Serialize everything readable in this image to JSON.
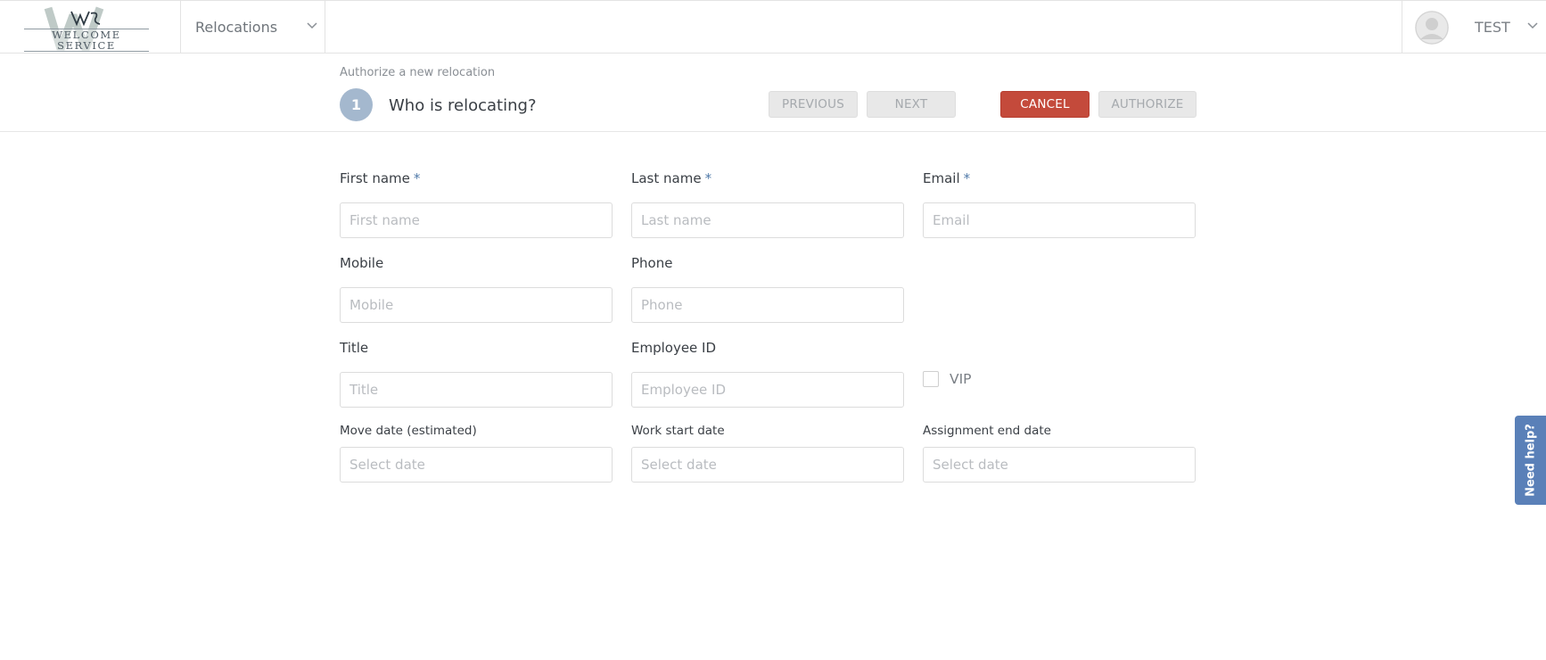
{
  "brand": {
    "logo_text": "WELCOME SERVICE"
  },
  "nav": {
    "module": "Relocations"
  },
  "user": {
    "name": "TEST"
  },
  "breadcrumb": "Authorize a new relocation",
  "step": {
    "number": "1",
    "title": "Who is relocating?"
  },
  "buttons": {
    "previous": "PREVIOUS",
    "next": "NEXT",
    "cancel": "CANCEL",
    "authorize": "AUTHORIZE"
  },
  "form": {
    "required_marker": "*",
    "first_name": {
      "label": "First name",
      "placeholder": "First name",
      "value": ""
    },
    "last_name": {
      "label": "Last name",
      "placeholder": "Last name",
      "value": ""
    },
    "email": {
      "label": "Email",
      "placeholder": "Email",
      "value": ""
    },
    "mobile": {
      "label": "Mobile",
      "placeholder": "Mobile",
      "value": ""
    },
    "phone": {
      "label": "Phone",
      "placeholder": "Phone",
      "value": ""
    },
    "title": {
      "label": "Title",
      "placeholder": "Title",
      "value": ""
    },
    "employee_id": {
      "label": "Employee ID",
      "placeholder": "Employee ID",
      "value": ""
    },
    "vip": {
      "label": "VIP",
      "checked": false
    },
    "move_date": {
      "label": "Move date (estimated)",
      "placeholder": "Select date",
      "value": ""
    },
    "work_start_date": {
      "label": "Work start date",
      "placeholder": "Select date",
      "value": ""
    },
    "assignment_end_date": {
      "label": "Assignment end date",
      "placeholder": "Select date",
      "value": ""
    }
  },
  "help": {
    "label": "Need help?"
  },
  "colors": {
    "cancel": "#c44a3b",
    "step_badge": "#a4b8ce",
    "required": "#4f79a8",
    "help_tab": "#5a80b8"
  }
}
